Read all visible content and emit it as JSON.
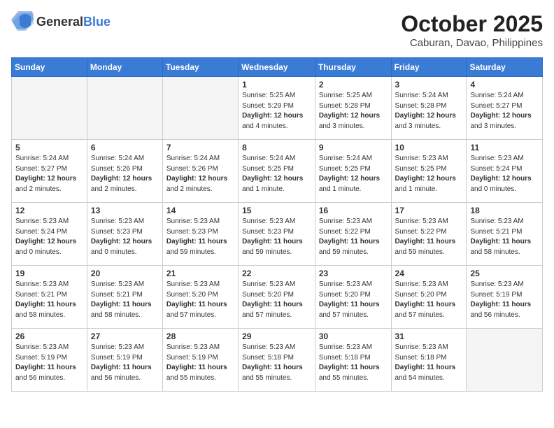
{
  "logo": {
    "general": "General",
    "blue": "Blue"
  },
  "header": {
    "month": "October 2025",
    "location": "Caburan, Davao, Philippines"
  },
  "weekdays": [
    "Sunday",
    "Monday",
    "Tuesday",
    "Wednesday",
    "Thursday",
    "Friday",
    "Saturday"
  ],
  "weeks": [
    [
      {
        "day": null,
        "info": null
      },
      {
        "day": null,
        "info": null
      },
      {
        "day": null,
        "info": null
      },
      {
        "day": "1",
        "info": "Sunrise: 5:25 AM\nSunset: 5:29 PM\nDaylight: 12 hours\nand 4 minutes."
      },
      {
        "day": "2",
        "info": "Sunrise: 5:25 AM\nSunset: 5:28 PM\nDaylight: 12 hours\nand 3 minutes."
      },
      {
        "day": "3",
        "info": "Sunrise: 5:24 AM\nSunset: 5:28 PM\nDaylight: 12 hours\nand 3 minutes."
      },
      {
        "day": "4",
        "info": "Sunrise: 5:24 AM\nSunset: 5:27 PM\nDaylight: 12 hours\nand 3 minutes."
      }
    ],
    [
      {
        "day": "5",
        "info": "Sunrise: 5:24 AM\nSunset: 5:27 PM\nDaylight: 12 hours\nand 2 minutes."
      },
      {
        "day": "6",
        "info": "Sunrise: 5:24 AM\nSunset: 5:26 PM\nDaylight: 12 hours\nand 2 minutes."
      },
      {
        "day": "7",
        "info": "Sunrise: 5:24 AM\nSunset: 5:26 PM\nDaylight: 12 hours\nand 2 minutes."
      },
      {
        "day": "8",
        "info": "Sunrise: 5:24 AM\nSunset: 5:25 PM\nDaylight: 12 hours\nand 1 minute."
      },
      {
        "day": "9",
        "info": "Sunrise: 5:24 AM\nSunset: 5:25 PM\nDaylight: 12 hours\nand 1 minute."
      },
      {
        "day": "10",
        "info": "Sunrise: 5:23 AM\nSunset: 5:25 PM\nDaylight: 12 hours\nand 1 minute."
      },
      {
        "day": "11",
        "info": "Sunrise: 5:23 AM\nSunset: 5:24 PM\nDaylight: 12 hours\nand 0 minutes."
      }
    ],
    [
      {
        "day": "12",
        "info": "Sunrise: 5:23 AM\nSunset: 5:24 PM\nDaylight: 12 hours\nand 0 minutes."
      },
      {
        "day": "13",
        "info": "Sunrise: 5:23 AM\nSunset: 5:23 PM\nDaylight: 12 hours\nand 0 minutes."
      },
      {
        "day": "14",
        "info": "Sunrise: 5:23 AM\nSunset: 5:23 PM\nDaylight: 11 hours\nand 59 minutes."
      },
      {
        "day": "15",
        "info": "Sunrise: 5:23 AM\nSunset: 5:23 PM\nDaylight: 11 hours\nand 59 minutes."
      },
      {
        "day": "16",
        "info": "Sunrise: 5:23 AM\nSunset: 5:22 PM\nDaylight: 11 hours\nand 59 minutes."
      },
      {
        "day": "17",
        "info": "Sunrise: 5:23 AM\nSunset: 5:22 PM\nDaylight: 11 hours\nand 59 minutes."
      },
      {
        "day": "18",
        "info": "Sunrise: 5:23 AM\nSunset: 5:21 PM\nDaylight: 11 hours\nand 58 minutes."
      }
    ],
    [
      {
        "day": "19",
        "info": "Sunrise: 5:23 AM\nSunset: 5:21 PM\nDaylight: 11 hours\nand 58 minutes."
      },
      {
        "day": "20",
        "info": "Sunrise: 5:23 AM\nSunset: 5:21 PM\nDaylight: 11 hours\nand 58 minutes."
      },
      {
        "day": "21",
        "info": "Sunrise: 5:23 AM\nSunset: 5:20 PM\nDaylight: 11 hours\nand 57 minutes."
      },
      {
        "day": "22",
        "info": "Sunrise: 5:23 AM\nSunset: 5:20 PM\nDaylight: 11 hours\nand 57 minutes."
      },
      {
        "day": "23",
        "info": "Sunrise: 5:23 AM\nSunset: 5:20 PM\nDaylight: 11 hours\nand 57 minutes."
      },
      {
        "day": "24",
        "info": "Sunrise: 5:23 AM\nSunset: 5:20 PM\nDaylight: 11 hours\nand 57 minutes."
      },
      {
        "day": "25",
        "info": "Sunrise: 5:23 AM\nSunset: 5:19 PM\nDaylight: 11 hours\nand 56 minutes."
      }
    ],
    [
      {
        "day": "26",
        "info": "Sunrise: 5:23 AM\nSunset: 5:19 PM\nDaylight: 11 hours\nand 56 minutes."
      },
      {
        "day": "27",
        "info": "Sunrise: 5:23 AM\nSunset: 5:19 PM\nDaylight: 11 hours\nand 56 minutes."
      },
      {
        "day": "28",
        "info": "Sunrise: 5:23 AM\nSunset: 5:19 PM\nDaylight: 11 hours\nand 55 minutes."
      },
      {
        "day": "29",
        "info": "Sunrise: 5:23 AM\nSunset: 5:18 PM\nDaylight: 11 hours\nand 55 minutes."
      },
      {
        "day": "30",
        "info": "Sunrise: 5:23 AM\nSunset: 5:18 PM\nDaylight: 11 hours\nand 55 minutes."
      },
      {
        "day": "31",
        "info": "Sunrise: 5:23 AM\nSunset: 5:18 PM\nDaylight: 11 hours\nand 54 minutes."
      },
      {
        "day": null,
        "info": null
      }
    ]
  ]
}
